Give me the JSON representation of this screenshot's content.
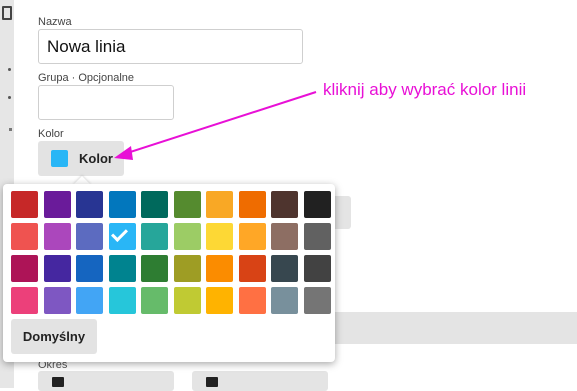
{
  "form": {
    "name_label": "Nazwa",
    "name_value": "Nowa linia",
    "group_label": "Grupa · Opcjonalne",
    "group_value": "",
    "color_label": "Kolor",
    "color_button_label": "Kolor",
    "selected_color": "#29b6f6",
    "period_label": "Okres"
  },
  "annotation": {
    "text": "kliknij aby wybrać kolor linii",
    "color": "#e810d6"
  },
  "palette": {
    "default_button_label": "Domyślny",
    "selected_index": 13,
    "colors": [
      "#c62828",
      "#6a1b9a",
      "#283593",
      "#0277bd",
      "#00695c",
      "#558b2f",
      "#f9a825",
      "#ef6c00",
      "#4e342e",
      "#212121",
      "#ef5350",
      "#ab47bc",
      "#5c6bc0",
      "#29b6f6",
      "#26a69a",
      "#9ccc65",
      "#fdd835",
      "#ffa726",
      "#8d6e63",
      "#616161",
      "#ad1457",
      "#4527a0",
      "#1565c0",
      "#00838f",
      "#2e7d32",
      "#9e9d24",
      "#fb8c00",
      "#d84315",
      "#37474f",
      "#424242",
      "#ec407a",
      "#7e57c2",
      "#42a5f5",
      "#26c6da",
      "#66bb6a",
      "#c0ca33",
      "#ffb300",
      "#ff7043",
      "#78909c",
      "#757575"
    ]
  }
}
